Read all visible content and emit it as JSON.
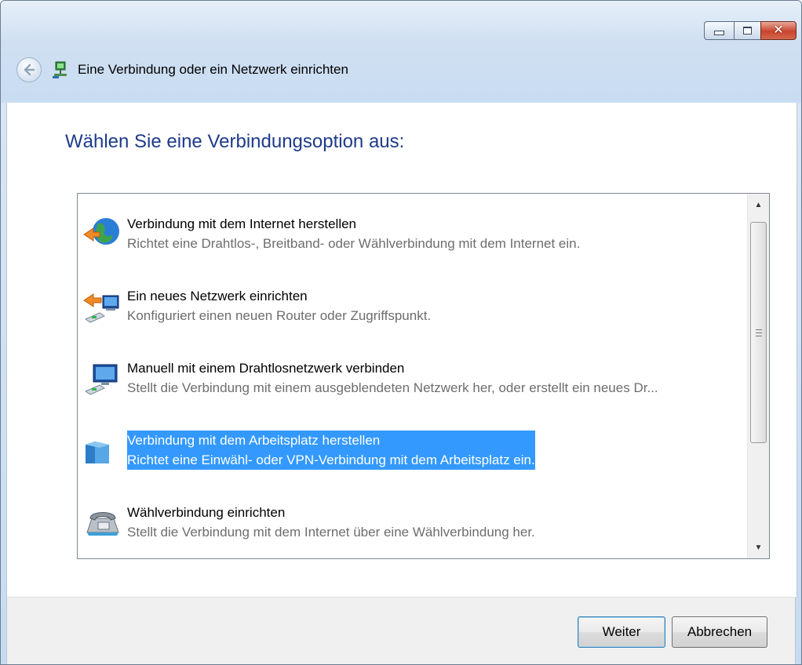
{
  "window": {
    "title": "Eine Verbindung oder ein Netzwerk einrichten",
    "icons": {
      "back": "back-arrow-icon",
      "app": "network-setup-icon",
      "minimize": "minimize-icon",
      "maximize": "maximize-icon",
      "close": "close-icon"
    }
  },
  "main": {
    "heading": "Wählen Sie eine Verbindungsoption aus:",
    "options": [
      {
        "title": "Verbindung mit dem Internet herstellen",
        "description": "Richtet eine Drahtlos-, Breitband- oder Wählverbindung mit dem Internet ein.",
        "icon": "globe-connection-icon",
        "selected": false
      },
      {
        "title": "Ein neues Netzwerk einrichten",
        "description": "Konfiguriert einen neuen Router oder Zugriffspunkt.",
        "icon": "new-network-icon",
        "selected": false
      },
      {
        "title": "Manuell mit einem Drahtlosnetzwerk verbinden",
        "description": "Stellt die Verbindung mit einem ausgeblendeten Netzwerk her, oder erstellt ein neues Dr...",
        "icon": "wireless-network-icon",
        "selected": false
      },
      {
        "title": "Verbindung mit dem Arbeitsplatz herstellen",
        "description": "Richtet eine Einwähl- oder VPN-Verbindung mit dem Arbeitsplatz ein.",
        "icon": "workplace-building-icon",
        "selected": true
      },
      {
        "title": "Wählverbindung einrichten",
        "description": "Stellt die Verbindung mit dem Internet über eine Wählverbindung her.",
        "icon": "telephone-modem-icon",
        "selected": false
      }
    ]
  },
  "footer": {
    "next_label": "Weiter",
    "cancel_label": "Abbrechen"
  },
  "colors": {
    "selection": "#3399ff",
    "heading": "#1e3b8a",
    "description": "#6d6d6d"
  }
}
